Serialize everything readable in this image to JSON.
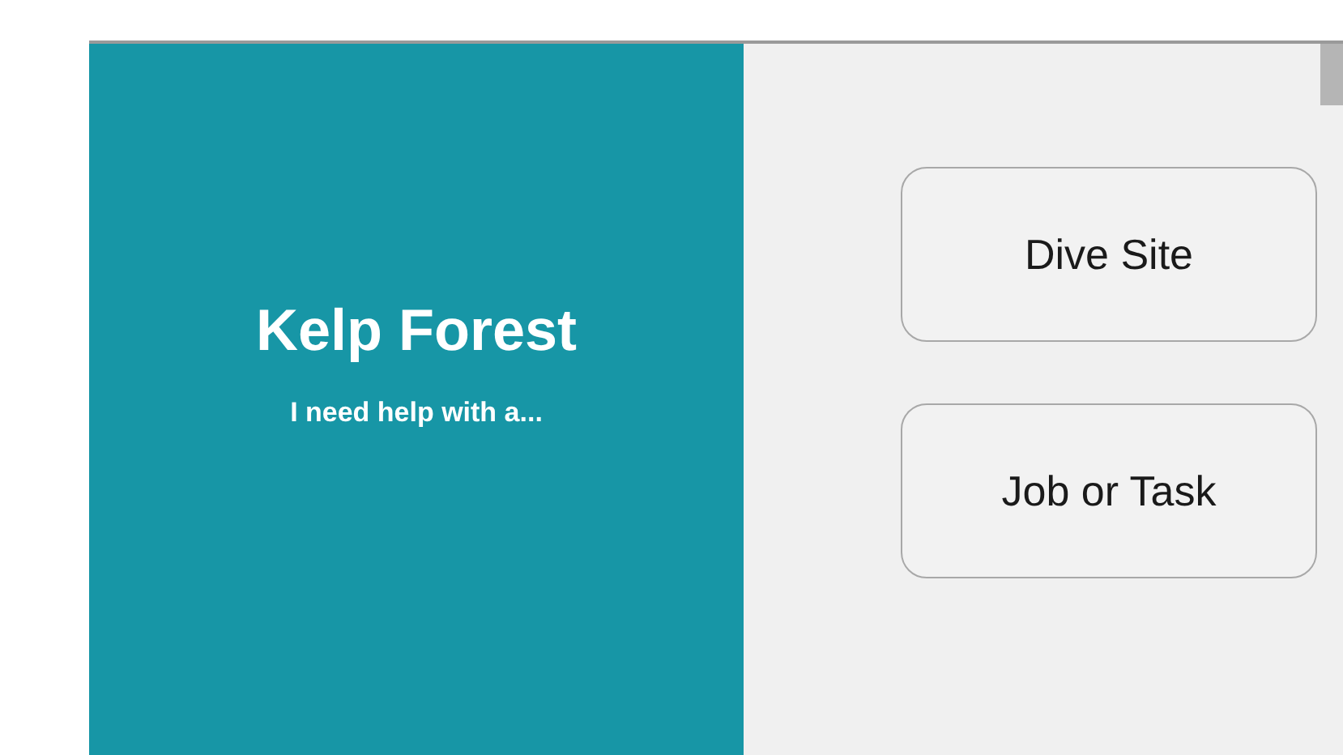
{
  "hero": {
    "title": "Kelp Forest",
    "subtitle": "I need help with a..."
  },
  "options": [
    {
      "label": "Dive Site"
    },
    {
      "label": "Job or Task"
    }
  ]
}
